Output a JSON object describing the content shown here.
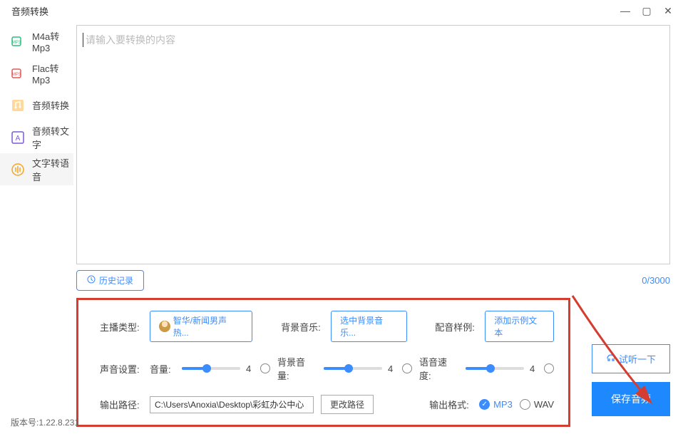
{
  "appTitle": "音频转换",
  "sidebar": {
    "items": [
      {
        "label": "M4a转Mp3"
      },
      {
        "label": "Flac转Mp3"
      },
      {
        "label": "音频转换"
      },
      {
        "label": "音频转文字"
      },
      {
        "label": "文字转语音"
      }
    ]
  },
  "textArea": {
    "placeholder": "请输入要转换的内容"
  },
  "history": {
    "label": "历史记录"
  },
  "charCount": "0/3000",
  "settings": {
    "anchorTypeLabel": "主播类型:",
    "anchorValue": "智华/新闻男声 热...",
    "bgMusicLabel": "背景音乐:",
    "bgMusicBtn": "选中背景音乐...",
    "sampleLabel": "配音样例:",
    "sampleBtn": "添加示例文本",
    "audioSettingsLabel": "声音设置:",
    "volumeLabel": "音量:",
    "volumeVal": "4",
    "bgVolumeLabel": "背景音量:",
    "bgVolumeVal": "4",
    "speedLabel": "语音速度:",
    "speedVal": "4",
    "outPathLabel": "输出路径:",
    "outPathVal": "C:\\Users\\Anoxia\\Desktop\\彩虹办公中心",
    "changePathBtn": "更改路径",
    "outFormatLabel": "输出格式:",
    "fmtMp3": "MP3",
    "fmtWav": "WAV"
  },
  "previewBtn": "试听一下",
  "saveBtn": "保存音频",
  "version": "版本号:1.22.8.231"
}
